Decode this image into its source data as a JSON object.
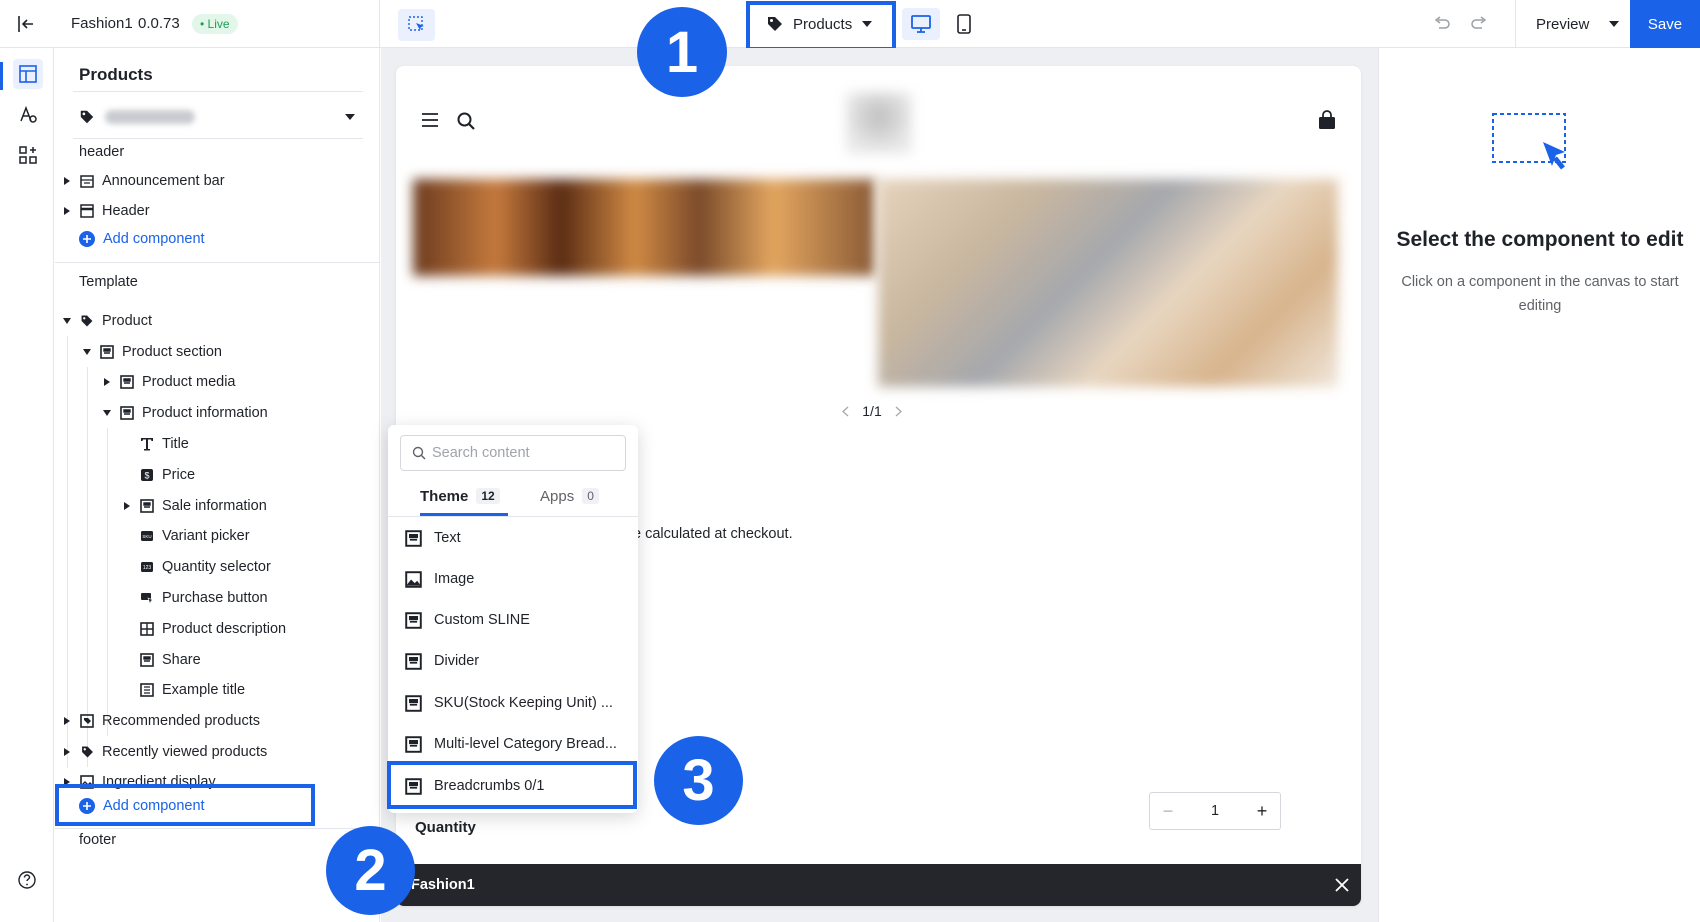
{
  "app": {
    "store_name": "Fashion1",
    "version": "0.0.73",
    "status_badge": "Live",
    "page_selector_label": "Products",
    "preview_label": "Preview",
    "save_label": "Save"
  },
  "sidebar": {
    "title": "Products",
    "groups": {
      "header": "header",
      "template": "Template",
      "footer": "footer"
    },
    "header_items": [
      "Announcement bar",
      "Header"
    ],
    "add_component_label": "Add component",
    "template_items": [
      "Product",
      "Product section",
      "Product media",
      "Product information",
      "Title",
      "Price",
      "Sale information",
      "Variant picker",
      "Quantity selector",
      "Purchase button",
      "Product description",
      "Share",
      "Example title",
      "Recommended products",
      "Recently viewed products",
      "Ingredient display"
    ]
  },
  "canvas": {
    "pagination": "1/1",
    "checkout_note": "e calculated at checkout.",
    "quantity_label": "Quantity",
    "quantity_value": "1",
    "quantity_minus": "−",
    "quantity_plus": "+",
    "toast_text": "Fashion1"
  },
  "picker": {
    "search_placeholder": "Search content",
    "tabs": [
      {
        "label": "Theme",
        "count": "12"
      },
      {
        "label": "Apps",
        "count": "0"
      }
    ],
    "items": [
      "Text",
      "Image",
      "Custom SLINE",
      "Divider",
      "SKU(Stock Keeping Unit) ...",
      "Multi-level Category Bread...",
      "Breadcrumbs 0/1"
    ]
  },
  "right_panel": {
    "title": "Select the component to edit",
    "subtitle": "Click on a component in the canvas to start editing"
  },
  "callouts": [
    "1",
    "2",
    "3"
  ],
  "colors": {
    "accent": "#1a62e8",
    "live_badge_bg": "#e3f6ea",
    "live_badge_text": "#1f9d55",
    "canvas_bg": "#eeeff3",
    "toast_bg": "#24262b"
  }
}
